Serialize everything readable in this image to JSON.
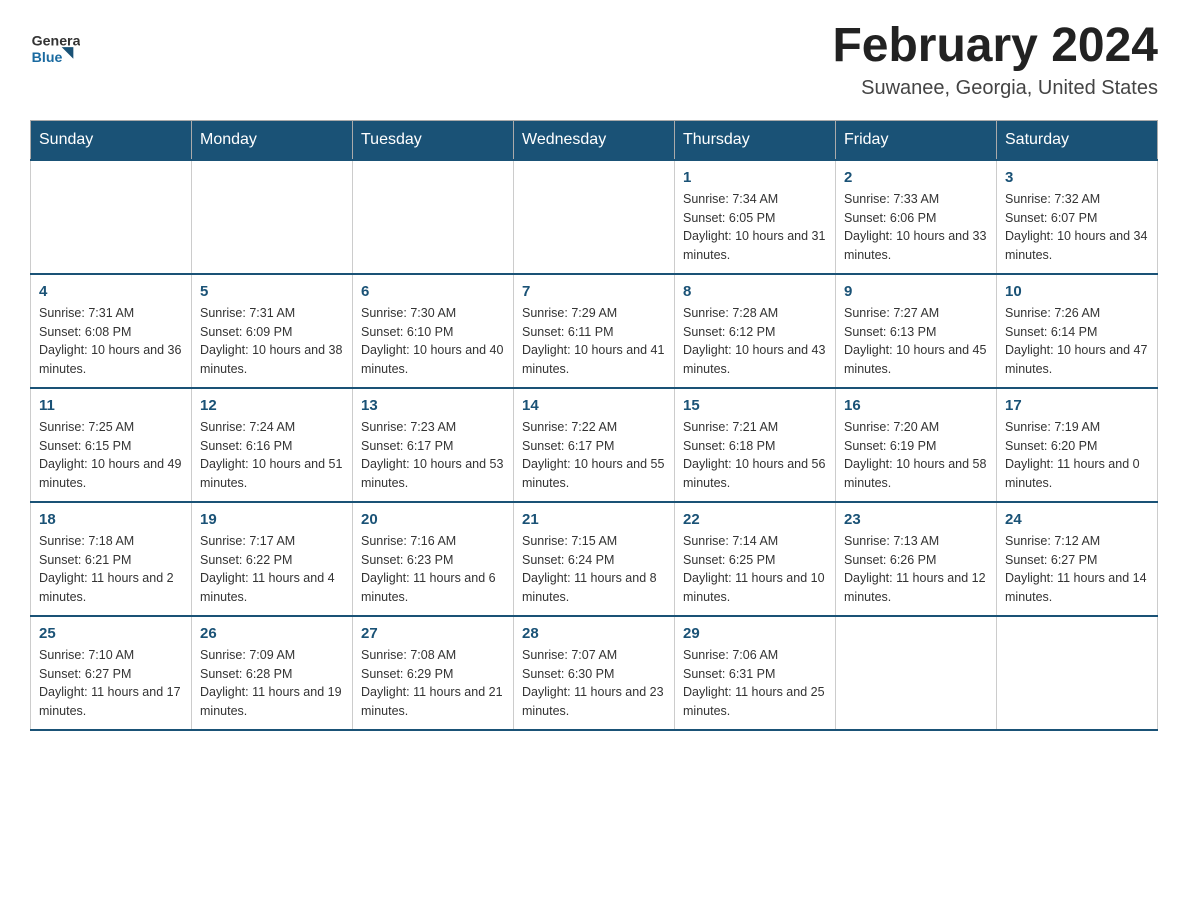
{
  "header": {
    "logo_general": "General",
    "logo_blue": "Blue",
    "month_title": "February 2024",
    "location": "Suwanee, Georgia, United States"
  },
  "days_of_week": [
    "Sunday",
    "Monday",
    "Tuesday",
    "Wednesday",
    "Thursday",
    "Friday",
    "Saturday"
  ],
  "weeks": [
    {
      "days": [
        {
          "number": "",
          "info": ""
        },
        {
          "number": "",
          "info": ""
        },
        {
          "number": "",
          "info": ""
        },
        {
          "number": "",
          "info": ""
        },
        {
          "number": "1",
          "info": "Sunrise: 7:34 AM\nSunset: 6:05 PM\nDaylight: 10 hours and 31 minutes."
        },
        {
          "number": "2",
          "info": "Sunrise: 7:33 AM\nSunset: 6:06 PM\nDaylight: 10 hours and 33 minutes."
        },
        {
          "number": "3",
          "info": "Sunrise: 7:32 AM\nSunset: 6:07 PM\nDaylight: 10 hours and 34 minutes."
        }
      ]
    },
    {
      "days": [
        {
          "number": "4",
          "info": "Sunrise: 7:31 AM\nSunset: 6:08 PM\nDaylight: 10 hours and 36 minutes."
        },
        {
          "number": "5",
          "info": "Sunrise: 7:31 AM\nSunset: 6:09 PM\nDaylight: 10 hours and 38 minutes."
        },
        {
          "number": "6",
          "info": "Sunrise: 7:30 AM\nSunset: 6:10 PM\nDaylight: 10 hours and 40 minutes."
        },
        {
          "number": "7",
          "info": "Sunrise: 7:29 AM\nSunset: 6:11 PM\nDaylight: 10 hours and 41 minutes."
        },
        {
          "number": "8",
          "info": "Sunrise: 7:28 AM\nSunset: 6:12 PM\nDaylight: 10 hours and 43 minutes."
        },
        {
          "number": "9",
          "info": "Sunrise: 7:27 AM\nSunset: 6:13 PM\nDaylight: 10 hours and 45 minutes."
        },
        {
          "number": "10",
          "info": "Sunrise: 7:26 AM\nSunset: 6:14 PM\nDaylight: 10 hours and 47 minutes."
        }
      ]
    },
    {
      "days": [
        {
          "number": "11",
          "info": "Sunrise: 7:25 AM\nSunset: 6:15 PM\nDaylight: 10 hours and 49 minutes."
        },
        {
          "number": "12",
          "info": "Sunrise: 7:24 AM\nSunset: 6:16 PM\nDaylight: 10 hours and 51 minutes."
        },
        {
          "number": "13",
          "info": "Sunrise: 7:23 AM\nSunset: 6:17 PM\nDaylight: 10 hours and 53 minutes."
        },
        {
          "number": "14",
          "info": "Sunrise: 7:22 AM\nSunset: 6:17 PM\nDaylight: 10 hours and 55 minutes."
        },
        {
          "number": "15",
          "info": "Sunrise: 7:21 AM\nSunset: 6:18 PM\nDaylight: 10 hours and 56 minutes."
        },
        {
          "number": "16",
          "info": "Sunrise: 7:20 AM\nSunset: 6:19 PM\nDaylight: 10 hours and 58 minutes."
        },
        {
          "number": "17",
          "info": "Sunrise: 7:19 AM\nSunset: 6:20 PM\nDaylight: 11 hours and 0 minutes."
        }
      ]
    },
    {
      "days": [
        {
          "number": "18",
          "info": "Sunrise: 7:18 AM\nSunset: 6:21 PM\nDaylight: 11 hours and 2 minutes."
        },
        {
          "number": "19",
          "info": "Sunrise: 7:17 AM\nSunset: 6:22 PM\nDaylight: 11 hours and 4 minutes."
        },
        {
          "number": "20",
          "info": "Sunrise: 7:16 AM\nSunset: 6:23 PM\nDaylight: 11 hours and 6 minutes."
        },
        {
          "number": "21",
          "info": "Sunrise: 7:15 AM\nSunset: 6:24 PM\nDaylight: 11 hours and 8 minutes."
        },
        {
          "number": "22",
          "info": "Sunrise: 7:14 AM\nSunset: 6:25 PM\nDaylight: 11 hours and 10 minutes."
        },
        {
          "number": "23",
          "info": "Sunrise: 7:13 AM\nSunset: 6:26 PM\nDaylight: 11 hours and 12 minutes."
        },
        {
          "number": "24",
          "info": "Sunrise: 7:12 AM\nSunset: 6:27 PM\nDaylight: 11 hours and 14 minutes."
        }
      ]
    },
    {
      "days": [
        {
          "number": "25",
          "info": "Sunrise: 7:10 AM\nSunset: 6:27 PM\nDaylight: 11 hours and 17 minutes."
        },
        {
          "number": "26",
          "info": "Sunrise: 7:09 AM\nSunset: 6:28 PM\nDaylight: 11 hours and 19 minutes."
        },
        {
          "number": "27",
          "info": "Sunrise: 7:08 AM\nSunset: 6:29 PM\nDaylight: 11 hours and 21 minutes."
        },
        {
          "number": "28",
          "info": "Sunrise: 7:07 AM\nSunset: 6:30 PM\nDaylight: 11 hours and 23 minutes."
        },
        {
          "number": "29",
          "info": "Sunrise: 7:06 AM\nSunset: 6:31 PM\nDaylight: 11 hours and 25 minutes."
        },
        {
          "number": "",
          "info": ""
        },
        {
          "number": "",
          "info": ""
        }
      ]
    }
  ]
}
